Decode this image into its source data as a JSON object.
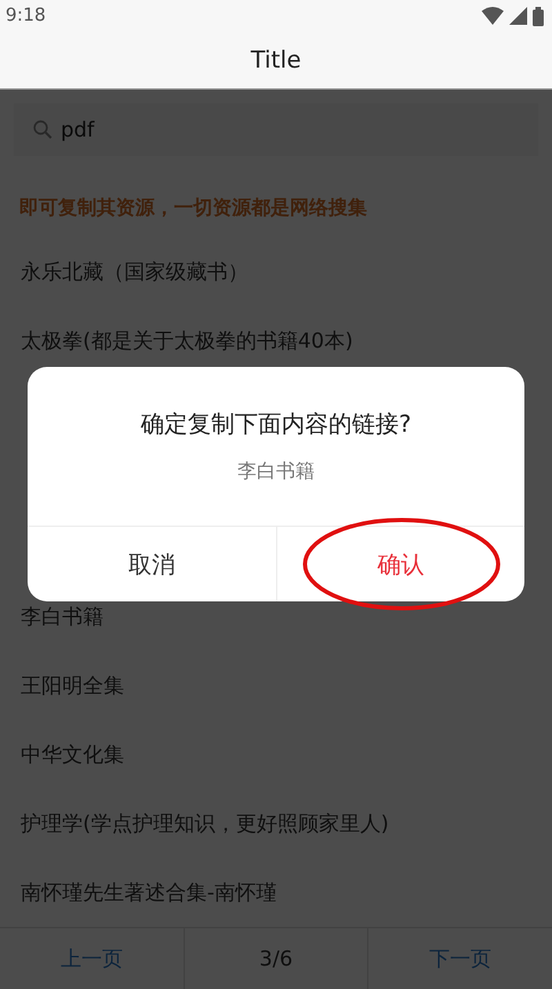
{
  "status_bar": {
    "time": "9:18"
  },
  "title": "Title",
  "search": {
    "value": "pdf"
  },
  "notice": "即可复制其资源，一切资源都是网络搜集",
  "list": {
    "top_items": [
      "永乐北藏（国家级藏书）",
      "太极拳(都是关于太极拳的书籍40本)"
    ],
    "bottom_items": [
      "李白书籍",
      "王阳明全集",
      "中华文化集",
      "护理学(学点护理知识，更好照顾家里人)",
      "南怀瑾先生著述合集-南怀瑾"
    ]
  },
  "dialog": {
    "title": "确定复制下面内容的链接?",
    "message": "李白书籍",
    "buttons": [
      {
        "label": "取消",
        "kind": "cancel",
        "circled": false
      },
      {
        "label": "确认",
        "kind": "confirm",
        "circled": true
      }
    ]
  },
  "pager": {
    "prev": "上一页",
    "page": "3/6",
    "next": "下一页"
  }
}
